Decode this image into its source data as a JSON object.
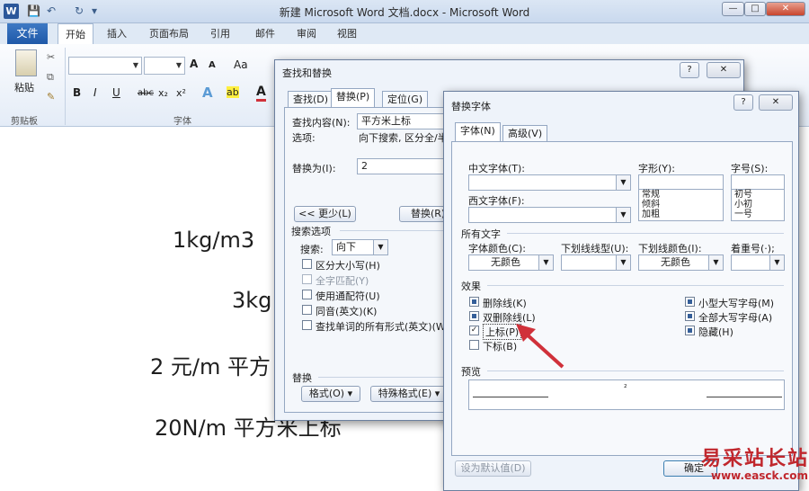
{
  "titlebar": {
    "title": "新建 Microsoft Word 文档.docx - Microsoft Word",
    "word_icon": "W",
    "save": "💾",
    "undo": "↶",
    "redo": "↻",
    "customize": "▾",
    "minimize": "—",
    "maximize": "□",
    "close": "✕"
  },
  "tabs": {
    "file": "文件",
    "home": "开始",
    "insert": "插入",
    "layout": "页面布局",
    "references": "引用",
    "mailings": "邮件",
    "review": "审阅",
    "view": "视图"
  },
  "ribbon": {
    "paste": "粘贴",
    "clipboard": "剪贴板",
    "font_group": "字体",
    "bold": "B",
    "italic": "I",
    "underline": "U",
    "strike": "abc",
    "subscript": "x₂",
    "superscript": "x²",
    "grow": "A",
    "shrink": "A",
    "changecase": "Aa",
    "effects": "A",
    "highlight": "ab",
    "fontcolor": "A"
  },
  "document": {
    "lines": [
      "1kg/m3",
      "3kg",
      "2 元/m 平方",
      "20N/m 平方米上标"
    ]
  },
  "find_replace": {
    "title": "查找和替换",
    "help": "?",
    "close": "✕",
    "tabs": [
      "查找(D)",
      "替换(P)",
      "定位(G)"
    ],
    "find_label": "查找内容(N):",
    "find_value": "平方米上标",
    "options_label": "选项:",
    "options_value": "向下搜索, 区分全/半角",
    "replace_label": "替换为(I):",
    "replace_value": "2",
    "less_button": "<< 更少(L)",
    "replace_button": "替换(R)",
    "search_options": "搜索选项",
    "search_label": "搜索:",
    "search_value": "向下",
    "checks": [
      "区分大小写(H)",
      "全字匹配(Y)",
      "使用通配符(U)",
      "同音(英文)(K)",
      "查找单词的所有形式(英文)(W)"
    ],
    "replace_section": "替换",
    "format_button": "格式(O) ▾",
    "special_button": "特殊格式(E) ▾"
  },
  "replace_font": {
    "title": "替换字体",
    "help": "?",
    "close": "✕",
    "tabs": [
      "字体(N)",
      "高级(V)"
    ],
    "cn_font_label": "中文字体(T):",
    "west_font_label": "西文字体(F):",
    "style_label": "字形(Y):",
    "style_options": [
      "常规",
      "倾斜",
      "加粗"
    ],
    "size_label": "字号(S):",
    "size_options": [
      "初号",
      "小初",
      "一号"
    ],
    "all_text": "所有文字",
    "color_label": "字体颜色(C):",
    "color_value": "无颜色",
    "underline_label": "下划线线型(U):",
    "underline_value": "",
    "underline_color_label": "下划线颜色(I):",
    "underline_color_value": "无颜色",
    "emphasis_label": "着重号(·);",
    "emphasis_value": "",
    "effects": "效果",
    "left_effects": [
      "删除线(K)",
      "双删除线(L)",
      "上标(P)",
      "下标(B)"
    ],
    "right_effects": [
      "小型大写字母(M)",
      "全部大写字母(A)",
      "隐藏(H)"
    ],
    "preview": "预览",
    "preview_char": "²",
    "default_button": "设为默认值(D)",
    "ok_button": "确定"
  },
  "watermark": {
    "text": "易采站长站",
    "url": "www.easck.com"
  },
  "colors": {
    "accent": "#2b579a",
    "arrow": "#d0313a",
    "watermark": "#c0272d"
  }
}
